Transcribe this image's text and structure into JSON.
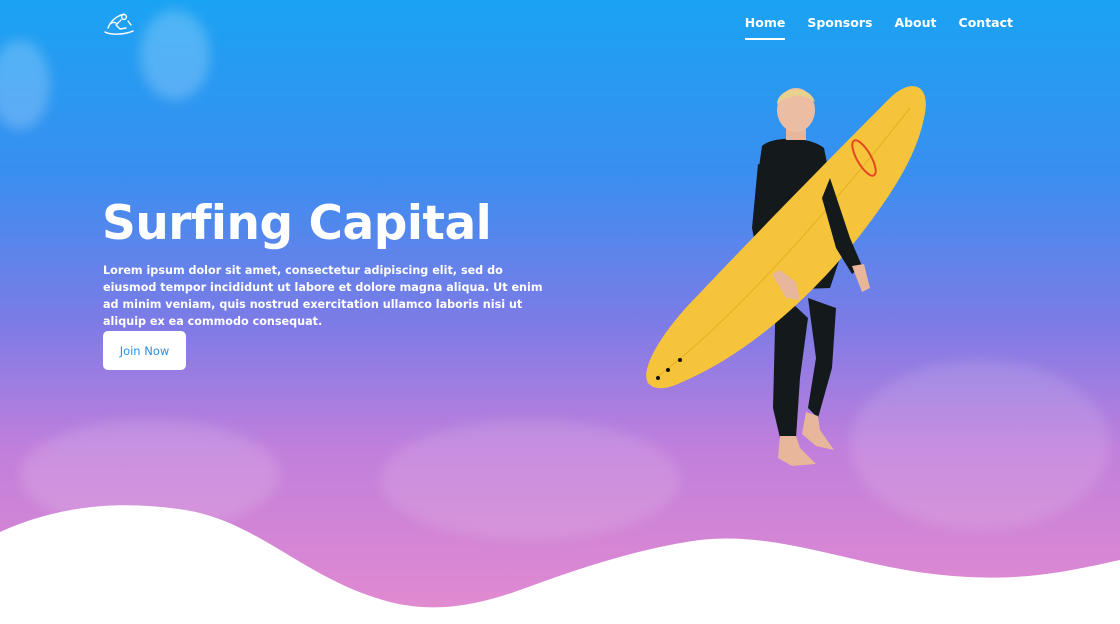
{
  "nav": {
    "items": [
      {
        "label": "Home",
        "active": true
      },
      {
        "label": "Sponsors",
        "active": false
      },
      {
        "label": "About",
        "active": false
      },
      {
        "label": "Contact",
        "active": false
      }
    ]
  },
  "hero": {
    "title": "Surfing Capital",
    "text": "Lorem ipsum dolor sit amet, consectetur adipiscing elit, sed do eiusmod tempor incididunt ut labore et dolore magna aliqua. Ut enim ad minim veniam, quis nostrud exercitation ullamco laboris nisi ut aliquip ex ea commodo consequat.",
    "cta_label": "Join Now"
  },
  "icons": {
    "logo": "surfer-logo-icon"
  },
  "colors": {
    "gradient_top": "#1aa3f3",
    "gradient_mid": "#7e7be6",
    "gradient_bottom": "#e48bcf",
    "button_text": "#2a8fe6",
    "board": "#f6c43a"
  }
}
